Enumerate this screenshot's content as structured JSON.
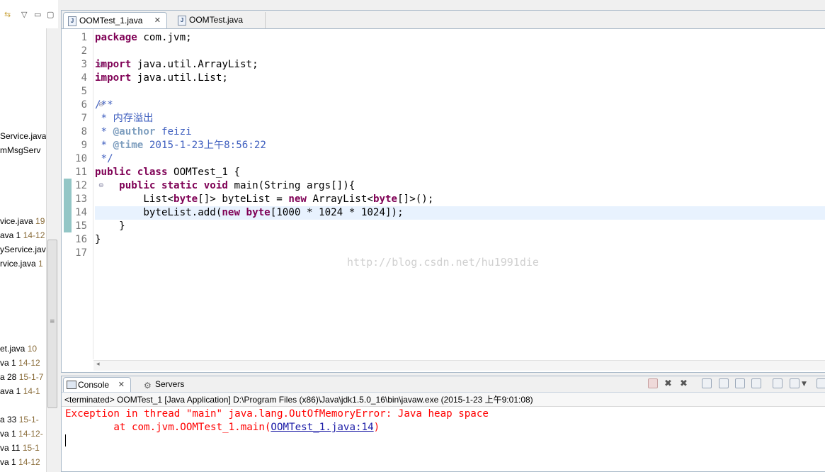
{
  "left_panel": {
    "items": [
      {
        "name": "Service.java",
        "decoration": ""
      },
      {
        "name": "mMsgServ",
        "decoration": ""
      },
      {
        "name": "vice.java",
        "decoration": "19"
      },
      {
        "name": "ava 1",
        "decoration": "14-12"
      },
      {
        "name": "yService.jav",
        "decoration": ""
      },
      {
        "name": "rvice.java",
        "decoration": "1"
      },
      {
        "name": "et.java",
        "decoration": "10"
      },
      {
        "name": "va 1",
        "decoration": "14-12"
      },
      {
        "name": "a 28",
        "decoration": "15-1-7"
      },
      {
        "name": "ava 1",
        "decoration": "14-1"
      },
      {
        "name": "a 33",
        "decoration": "15-1-"
      },
      {
        "name": "va 1",
        "decoration": "14-12-"
      },
      {
        "name": "va 11",
        "decoration": "15-1"
      },
      {
        "name": "va 1",
        "decoration": "14-12"
      }
    ]
  },
  "editor": {
    "tabs": [
      {
        "label": "OOMTest_1.java",
        "active": true
      },
      {
        "label": "OOMTest.java",
        "active": false
      }
    ],
    "lines": [
      {
        "n": "1",
        "segs": [
          {
            "t": "package",
            "c": "kw"
          },
          {
            "t": " com.jvm;",
            "c": ""
          }
        ]
      },
      {
        "n": "2",
        "segs": []
      },
      {
        "n": "3",
        "fold": true,
        "segs": [
          {
            "t": "import",
            "c": "kw"
          },
          {
            "t": " java.util.ArrayList;",
            "c": ""
          }
        ]
      },
      {
        "n": "4",
        "segs": [
          {
            "t": "import",
            "c": "kw"
          },
          {
            "t": " java.util.List;",
            "c": ""
          }
        ]
      },
      {
        "n": "5",
        "segs": []
      },
      {
        "n": "6",
        "fold": true,
        "segs": [
          {
            "t": "/**",
            "c": "cm"
          }
        ]
      },
      {
        "n": "7",
        "segs": [
          {
            "t": " * 内存溢出",
            "c": "cm"
          }
        ]
      },
      {
        "n": "8",
        "segs": [
          {
            "t": " * ",
            "c": "cm"
          },
          {
            "t": "@author",
            "c": "tag"
          },
          {
            "t": " feizi",
            "c": "cm"
          }
        ]
      },
      {
        "n": "9",
        "segs": [
          {
            "t": " * ",
            "c": "cm"
          },
          {
            "t": "@time",
            "c": "tag"
          },
          {
            "t": " 2015-1-23上午8:56:22",
            "c": "cm"
          }
        ]
      },
      {
        "n": "10",
        "segs": [
          {
            "t": " */",
            "c": "cm"
          }
        ]
      },
      {
        "n": "11",
        "segs": [
          {
            "t": "public",
            "c": "kw"
          },
          {
            "t": " ",
            "c": ""
          },
          {
            "t": "class",
            "c": "kw"
          },
          {
            "t": " OOMTest_1 {",
            "c": ""
          }
        ]
      },
      {
        "n": "12",
        "fold": true,
        "segs": [
          {
            "t": "    ",
            "c": ""
          },
          {
            "t": "public",
            "c": "kw"
          },
          {
            "t": " ",
            "c": ""
          },
          {
            "t": "static",
            "c": "kw"
          },
          {
            "t": " ",
            "c": ""
          },
          {
            "t": "void",
            "c": "kw"
          },
          {
            "t": " main(String args[]){",
            "c": ""
          }
        ]
      },
      {
        "n": "13",
        "segs": [
          {
            "t": "        List<",
            "c": ""
          },
          {
            "t": "byte",
            "c": "kw"
          },
          {
            "t": "[]> byteList = ",
            "c": ""
          },
          {
            "t": "new",
            "c": "kw"
          },
          {
            "t": " ArrayList<",
            "c": ""
          },
          {
            "t": "byte",
            "c": "kw"
          },
          {
            "t": "[]>();",
            "c": ""
          }
        ]
      },
      {
        "n": "14",
        "highlight": true,
        "segs": [
          {
            "t": "        byteList.add(",
            "c": ""
          },
          {
            "t": "new",
            "c": "kw"
          },
          {
            "t": " ",
            "c": ""
          },
          {
            "t": "byte",
            "c": "kw"
          },
          {
            "t": "[1000 * 1024 * 1024]);",
            "c": ""
          }
        ]
      },
      {
        "n": "15",
        "segs": [
          {
            "t": "    }",
            "c": ""
          }
        ]
      },
      {
        "n": "16",
        "segs": [
          {
            "t": "}",
            "c": ""
          }
        ]
      },
      {
        "n": "17",
        "segs": []
      }
    ],
    "watermark": "http://blog.csdn.net/hu1991die"
  },
  "console": {
    "tabs": [
      {
        "label": "Console",
        "active": true
      },
      {
        "label": "Servers",
        "active": false
      }
    ],
    "terminated_text": "<terminated> OOMTest_1 [Java Application] D:\\Program Files (x86)\\Java\\jdk1.5.0_16\\bin\\javaw.exe (2015-1-23 上午9:01:08)",
    "error_line": "Exception in thread \"main\" java.lang.OutOfMemoryError: Java heap space",
    "stack_prefix": "        at com.jvm.OOMTest_1.main(",
    "stack_link": "OOMTest_1.java:14",
    "stack_suffix": ")"
  },
  "colors": {
    "keyword": "#7f0055",
    "comment": "#3f5fbf",
    "javadoc_tag": "#7f9fbf",
    "error_text": "#ff0000",
    "current_line": "#e8f2fe"
  }
}
